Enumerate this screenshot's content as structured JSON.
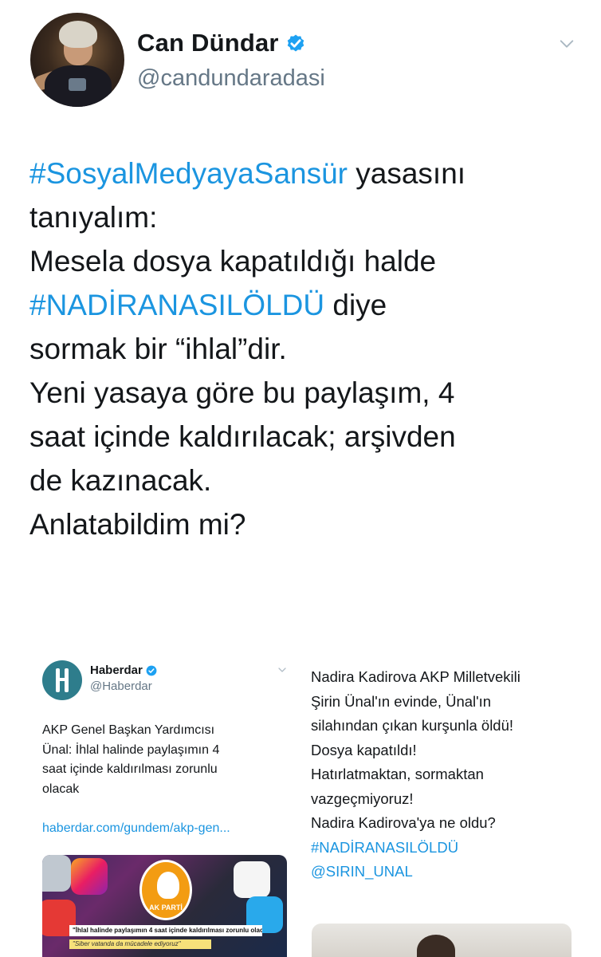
{
  "tweet": {
    "author": {
      "display_name": "Can Dündar",
      "handle": "@candundaradasi",
      "verified": true
    },
    "text_lines": [
      [
        {
          "text": "#SosyalMedyayaSansür",
          "hashtag": true
        },
        {
          "text": " yasasını",
          "hashtag": false
        }
      ],
      [
        {
          "text": "tanıyalım:",
          "hashtag": false
        }
      ],
      [
        {
          "text": "Mesela dosya kapatıldığı halde",
          "hashtag": false
        }
      ],
      [
        {
          "text": "#NADİRANASILÖLDÜ",
          "hashtag": true
        },
        {
          "text": " diye",
          "hashtag": false
        }
      ],
      [
        {
          "text": "sormak bir “ihlal”dir.",
          "hashtag": false
        }
      ],
      [
        {
          "text": "Yeni yasaya göre bu paylaşım, 4",
          "hashtag": false
        }
      ],
      [
        {
          "text": "saat içinde kaldırılacak; arşivden",
          "hashtag": false
        }
      ],
      [
        {
          "text": "de kazınacak.",
          "hashtag": false
        }
      ],
      [
        {
          "text": "Anlatabildim mi?",
          "hashtag": false
        }
      ]
    ]
  },
  "embedded_tweet": {
    "display_name": "Haberdar",
    "handle": "@Haberdar",
    "verified": true,
    "text_lines": [
      "AKP Genel Başkan Yardımcısı",
      "Ünal: İhlal halinde paylaşımın 4",
      "saat içinde kaldırılması zorunlu",
      "olacak"
    ],
    "link": "haberdar.com/gundem/akp-gen...",
    "image": {
      "logo_label": "AK PARTİ",
      "banner_1": "\"İhlal halinde paylaşımın 4 saat içinde kaldırılması zorunlu olacak\"",
      "banner_2": "\"Siber vatanda da mücadele ediyoruz\""
    }
  },
  "right_panel": {
    "paragraph_1": [
      "Nadira Kadirova AKP Milletvekili",
      "Şirin Ünal'ın evinde, Ünal'ın",
      "silahından çıkan kurşunla öldü!",
      "Dosya kapatıldı!"
    ],
    "paragraph_2": [
      "Hatırlatmaktan, sormaktan",
      "vazgeçmiyoruz!",
      "Nadira Kadirova'ya ne oldu?"
    ],
    "hashtag": "#NADİRANASILÖLDÜ",
    "mention": "@SIRIN_UNAL"
  },
  "colors": {
    "link_blue": "#1b95e0",
    "verified_blue": "#1da1f2",
    "secondary_gray": "#657786",
    "text_dark": "#14171a"
  },
  "icons": [
    "verified-badge-icon",
    "chevron-down-icon"
  ]
}
